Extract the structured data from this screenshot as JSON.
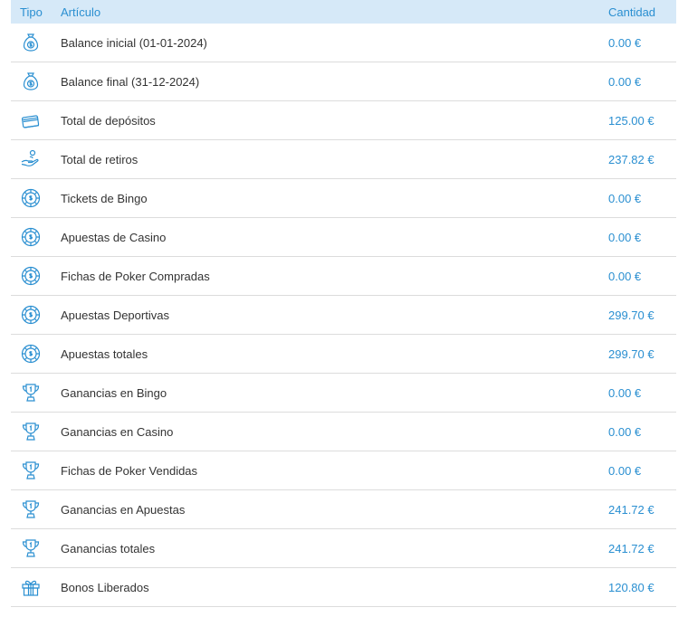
{
  "header": {
    "type": "Tipo",
    "item": "Artículo",
    "amount": "Cantidad"
  },
  "rows": [
    {
      "icon": "money-bag-icon",
      "label": "Balance inicial (01-01-2024)",
      "amount": "0.00 €"
    },
    {
      "icon": "money-bag-icon",
      "label": "Balance final (31-12-2024)",
      "amount": "0.00 €"
    },
    {
      "icon": "card-icon",
      "label": "Total de depósitos",
      "amount": "125.00 €"
    },
    {
      "icon": "hand-coin-icon",
      "label": "Total de retiros",
      "amount": "237.82 €"
    },
    {
      "icon": "chip-icon",
      "label": "Tickets de Bingo",
      "amount": "0.00 €"
    },
    {
      "icon": "chip-icon",
      "label": "Apuestas de Casino",
      "amount": "0.00 €"
    },
    {
      "icon": "chip-icon",
      "label": "Fichas de Poker Compradas",
      "amount": "0.00 €"
    },
    {
      "icon": "chip-icon",
      "label": "Apuestas Deportivas",
      "amount": "299.70 €"
    },
    {
      "icon": "chip-icon",
      "label": "Apuestas totales",
      "amount": "299.70 €"
    },
    {
      "icon": "trophy-icon",
      "label": "Ganancias en Bingo",
      "amount": "0.00 €"
    },
    {
      "icon": "trophy-icon",
      "label": "Ganancias en Casino",
      "amount": "0.00 €"
    },
    {
      "icon": "trophy-icon",
      "label": "Fichas de Poker Vendidas",
      "amount": "0.00 €"
    },
    {
      "icon": "trophy-icon",
      "label": "Ganancias en Apuestas",
      "amount": "241.72 €"
    },
    {
      "icon": "trophy-icon",
      "label": "Ganancias totales",
      "amount": "241.72 €"
    },
    {
      "icon": "gift-icon",
      "label": "Bonos Liberados",
      "amount": "120.80 €"
    }
  ],
  "colors": {
    "accent": "#2a8fd1",
    "header_bg": "#d6e9f8",
    "text": "#333333",
    "divider": "#dcdcdc"
  }
}
